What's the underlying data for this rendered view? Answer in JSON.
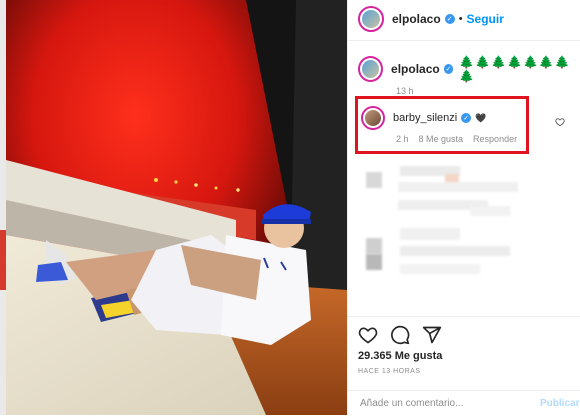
{
  "post": {
    "author": {
      "username": "elpolaco",
      "follow_label": "Seguir",
      "dot": "•"
    },
    "caption": {
      "username": "elpolaco",
      "text": "🌲🌲🌲🌲🌲🌲🌲🌲",
      "time": "13 h"
    },
    "highlighted_comment": {
      "username": "barby_silenzi",
      "emoji": "🖤",
      "time": "2 h",
      "likes": "8 Me gusta",
      "reply_label": "Responder"
    },
    "likes_count": "29.365 Me gusta",
    "posted_ago": "HACE 13 HORAS",
    "comment_input": {
      "placeholder": "Añade un comentario..."
    },
    "publish_label": "Publicar"
  },
  "icons": {
    "verified": "verified-badge-icon",
    "like": "heart-outline-icon",
    "comment": "comment-bubble-icon",
    "share": "paper-plane-icon",
    "comment_like": "heart-small-icon"
  },
  "colors": {
    "accent": "#0095f6",
    "highlight_border": "#e0141e",
    "verified": "#3897f0"
  }
}
